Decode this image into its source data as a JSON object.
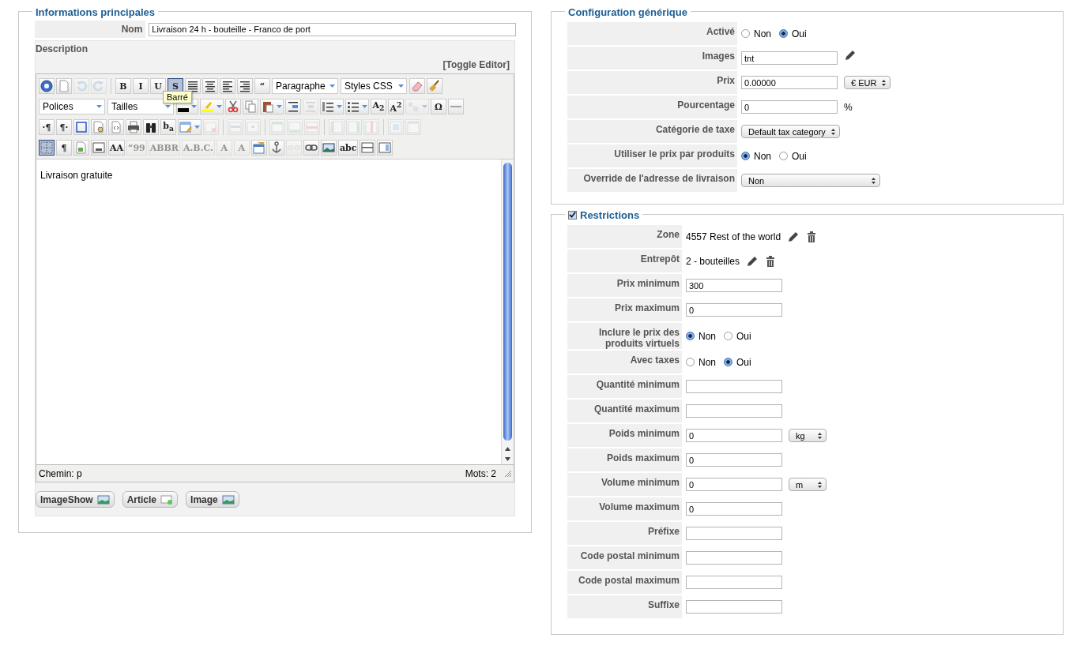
{
  "main_info": {
    "legend": "Informations principales",
    "name": {
      "label": "Nom",
      "value": "Livraison 24 h - bouteille - Franco de port"
    },
    "description": {
      "label": "Description",
      "toggle": "[Toggle Editor]",
      "toolbar": [
        [
          {
            "kind": "icon",
            "disabled": false,
            "selected": false
          },
          {
            "kind": "icon",
            "disabled": false,
            "selected": false
          },
          {
            "kind": "icon",
            "disabled": true,
            "selected": false
          },
          {
            "kind": "icon",
            "disabled": true,
            "selected": false
          },
          {
            "kind": "sep"
          },
          {
            "kind": "glyph",
            "text": "B",
            "disabled": false,
            "selected": false
          },
          {
            "kind": "glyph",
            "text": "I",
            "disabled": false,
            "selected": false
          },
          {
            "kind": "glyph",
            "text": "U",
            "disabled": false,
            "selected": false
          },
          {
            "kind": "glyph",
            "text": "S",
            "disabled": false,
            "selected": true
          },
          {
            "kind": "icon",
            "disabled": false,
            "selected": false
          },
          {
            "kind": "icon",
            "disabled": false,
            "selected": false
          },
          {
            "kind": "icon",
            "disabled": false,
            "selected": false
          },
          {
            "kind": "icon",
            "disabled": false,
            "selected": false
          },
          {
            "kind": "glyph",
            "text": "“",
            "disabled": false,
            "selected": false
          },
          {
            "kind": "select",
            "text": "Paragraphe"
          },
          {
            "kind": "select",
            "text": "Styles CSS"
          },
          {
            "kind": "icon",
            "disabled": false,
            "selected": false
          },
          {
            "kind": "icon",
            "disabled": false,
            "selected": false
          }
        ],
        [
          {
            "kind": "select",
            "text": "Polices"
          },
          {
            "kind": "select",
            "text": "Tailles"
          },
          {
            "kind": "icon",
            "split": true,
            "disabled": false,
            "selected": false
          },
          {
            "kind": "icon",
            "split": true,
            "disabled": false,
            "selected": false
          },
          {
            "kind": "icon",
            "disabled": false,
            "selected": false
          },
          {
            "kind": "icon",
            "disabled": false,
            "selected": false
          },
          {
            "kind": "icon",
            "split": true,
            "disabled": false,
            "selected": false
          },
          {
            "kind": "icon",
            "disabled": false,
            "selected": false
          },
          {
            "kind": "icon",
            "disabled": true,
            "selected": false
          },
          {
            "kind": "icon",
            "split": true,
            "disabled": false,
            "selected": false
          },
          {
            "kind": "icon",
            "split": true,
            "disabled": false,
            "selected": false
          },
          {
            "kind": "glyph",
            "text": "A$_{2}$",
            "disabled": false,
            "selected": false
          },
          {
            "kind": "glyph",
            "text": "A$^{2}$",
            "disabled": false,
            "selected": false
          },
          {
            "kind": "icon",
            "split": true,
            "disabled": true,
            "selected": false
          },
          {
            "kind": "glyph",
            "text": "Ω",
            "disabled": false,
            "selected": false
          },
          {
            "kind": "icon",
            "disabled": false,
            "selected": false
          }
        ],
        [
          {
            "kind": "glyph",
            "text": "·¶",
            "disabled": false,
            "selected": false
          },
          {
            "kind": "glyph",
            "text": "¶·",
            "disabled": false,
            "selected": false
          },
          {
            "kind": "icon",
            "disabled": false,
            "selected": false
          },
          {
            "kind": "icon",
            "disabled": false,
            "selected": false
          },
          {
            "kind": "icon",
            "disabled": false,
            "selected": false
          },
          {
            "kind": "icon",
            "disabled": false,
            "selected": false
          },
          {
            "kind": "icon",
            "disabled": false,
            "selected": false
          },
          {
            "kind": "glyph",
            "text": "b$_{a}$",
            "disabled": false,
            "selected": false
          },
          {
            "kind": "icon",
            "split": true,
            "disabled": false,
            "selected": false
          },
          {
            "kind": "icon",
            "disabled": true,
            "selected": false
          },
          {
            "kind": "sep"
          },
          {
            "kind": "icon",
            "disabled": true,
            "selected": false
          },
          {
            "kind": "icon",
            "disabled": true,
            "selected": false
          },
          {
            "kind": "sep"
          },
          {
            "kind": "icon",
            "disabled": true,
            "selected": false
          },
          {
            "kind": "icon",
            "disabled": true,
            "selected": false
          },
          {
            "kind": "icon",
            "disabled": true,
            "selected": false
          },
          {
            "kind": "sep"
          },
          {
            "kind": "icon",
            "disabled": true,
            "selected": false
          },
          {
            "kind": "icon",
            "disabled": true,
            "selected": false
          },
          {
            "kind": "icon",
            "disabled": true,
            "selected": false
          },
          {
            "kind": "sep"
          },
          {
            "kind": "icon",
            "disabled": true,
            "selected": false
          },
          {
            "kind": "icon",
            "disabled": true,
            "selected": false
          }
        ],
        [
          {
            "kind": "icon",
            "disabled": false,
            "selected": true
          },
          {
            "kind": "glyph",
            "text": "¶",
            "disabled": false,
            "selected": false
          },
          {
            "kind": "icon",
            "disabled": false,
            "selected": false
          },
          {
            "kind": "icon",
            "disabled": false,
            "selected": false
          },
          {
            "kind": "glyph",
            "text": "AA",
            "disabled": false,
            "selected": false
          },
          {
            "kind": "glyph",
            "text": "“99",
            "disabled": true,
            "selected": false
          },
          {
            "kind": "glyph",
            "text": "ABBR",
            "disabled": true,
            "selected": false
          },
          {
            "kind": "glyph",
            "text": "A.B.C.",
            "disabled": true,
            "selected": false
          },
          {
            "kind": "glyph",
            "text": "A",
            "disabled": true,
            "selected": false
          },
          {
            "kind": "glyph",
            "text": "A",
            "disabled": true,
            "selected": false
          },
          {
            "kind": "icon",
            "disabled": false,
            "selected": false
          },
          {
            "kind": "icon",
            "disabled": false,
            "selected": false
          },
          {
            "kind": "icon",
            "disabled": true,
            "selected": false
          },
          {
            "kind": "icon",
            "disabled": false,
            "selected": false
          },
          {
            "kind": "icon",
            "disabled": false,
            "selected": false
          },
          {
            "kind": "glyph",
            "text": "abc",
            "disabled": false,
            "selected": false
          },
          {
            "kind": "icon",
            "disabled": false,
            "selected": false
          },
          {
            "kind": "icon",
            "disabled": false,
            "selected": false
          }
        ]
      ],
      "tooltip": "Barré",
      "content": "Livraison gratuite",
      "path": "Chemin: p",
      "words": "Mots: 2"
    },
    "buttons": [
      {
        "label": "ImageShow"
      },
      {
        "label": "Article"
      },
      {
        "label": "Image"
      }
    ]
  },
  "generic_config": {
    "legend": "Configuration générique",
    "rows": [
      {
        "kind": "radio",
        "label": "Activé",
        "options": [
          {
            "label": "Non",
            "selected": false
          },
          {
            "label": "Oui",
            "selected": true
          }
        ]
      },
      {
        "kind": "text",
        "label": "Images",
        "value": "tnt",
        "edit": true
      },
      {
        "kind": "text",
        "label": "Prix",
        "value": "0.00000",
        "unit": "€ EUR"
      },
      {
        "kind": "text",
        "label": "Pourcentage",
        "value": "0",
        "suffix": "%"
      },
      {
        "kind": "select",
        "label": "Catégorie de taxe",
        "value": "Default tax category"
      },
      {
        "kind": "radio",
        "label": "Utiliser le prix par produits",
        "options": [
          {
            "label": "Non",
            "selected": true
          },
          {
            "label": "Oui",
            "selected": false
          }
        ]
      },
      {
        "kind": "select",
        "label": "Override de l'adresse de livraison",
        "value": "Non"
      }
    ]
  },
  "restrictions": {
    "legend": "Restrictions",
    "checked": true,
    "rows": [
      {
        "kind": "item",
        "label": "Zone",
        "value": "4557 Rest of the world"
      },
      {
        "kind": "item",
        "label": "Entrepôt",
        "value": "2 - bouteilles"
      },
      {
        "kind": "text",
        "label": "Prix minimum",
        "value": "300"
      },
      {
        "kind": "text",
        "label": "Prix maximum",
        "value": "0"
      },
      {
        "kind": "radio",
        "label": "Inclure le prix des produits virtuels",
        "options": [
          {
            "label": "Non",
            "selected": true
          },
          {
            "label": "Oui",
            "selected": false
          }
        ]
      },
      {
        "kind": "radio",
        "label": "Avec taxes",
        "options": [
          {
            "label": "Non",
            "selected": false
          },
          {
            "label": "Oui",
            "selected": true
          }
        ]
      },
      {
        "kind": "text",
        "label": "Quantité minimum"
      },
      {
        "kind": "text",
        "label": "Quantité maximum"
      },
      {
        "kind": "text",
        "label": "Poids minimum",
        "value": "0",
        "unit": "kg"
      },
      {
        "kind": "text",
        "label": "Poids maximum",
        "value": "0"
      },
      {
        "kind": "text",
        "label": "Volume minimum",
        "value": "0",
        "unit": "m"
      },
      {
        "kind": "text",
        "label": "Volume maximum",
        "value": "0"
      },
      {
        "kind": "text",
        "label": "Préfixe"
      },
      {
        "kind": "text",
        "label": "Code postal minimum"
      },
      {
        "kind": "text",
        "label": "Code postal maximum"
      },
      {
        "kind": "text",
        "label": "Suffixe"
      }
    ]
  }
}
